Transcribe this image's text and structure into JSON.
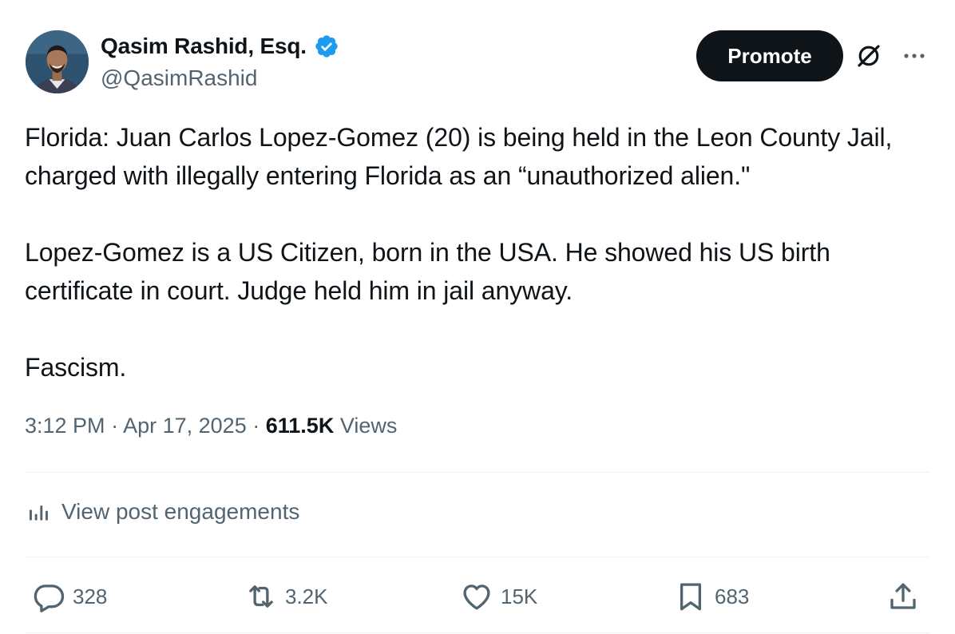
{
  "author": {
    "display_name": "Qasim Rashid, Esq.",
    "handle": "@QasimRashid",
    "verified": true,
    "verified_color": "#1d9bf0"
  },
  "header": {
    "promote_label": "Promote",
    "icons": [
      "grok-icon",
      "more-icon"
    ]
  },
  "post": {
    "paragraphs": [
      "Florida: Juan Carlos Lopez-Gomez (20) is being held in the Leon County Jail, charged with illegally entering Florida as an “unauthorized alien.\"",
      "Lopez-Gomez is a US Citizen, born in the USA. He showed his US birth certificate in court. Judge held him in jail anyway.",
      "Fascism."
    ]
  },
  "meta": {
    "time": "3:12 PM",
    "separator": "·",
    "date": "Apr 17, 2025",
    "views_count": "611.5K",
    "views_label": "Views"
  },
  "engagements": {
    "label": "View post engagements",
    "icon": "analytics-icon"
  },
  "actions": {
    "replies": "328",
    "reposts": "3.2K",
    "likes": "15K",
    "bookmarks": "683"
  },
  "colors": {
    "text_primary": "#0f1419",
    "text_secondary": "#536471",
    "divider": "#eff3f4",
    "button_bg": "#0f1419"
  }
}
